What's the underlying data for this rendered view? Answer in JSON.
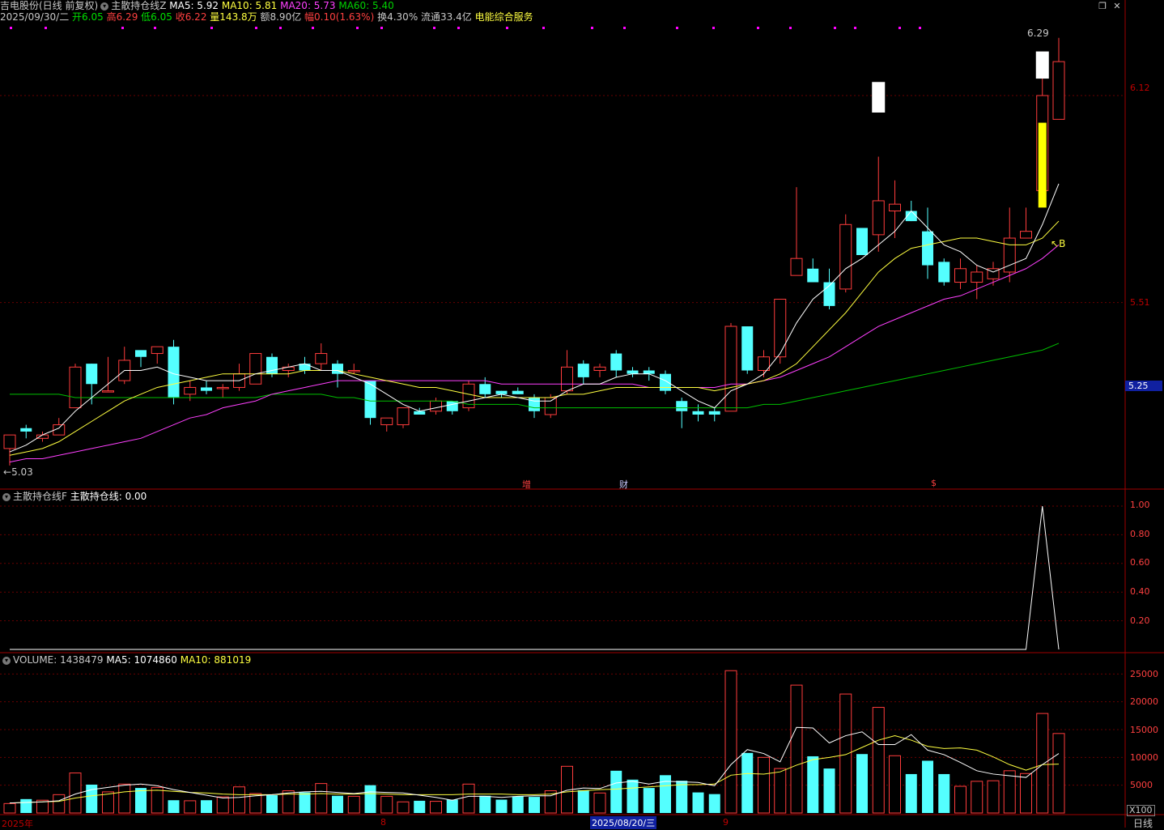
{
  "header": {
    "stock_name": "吉电股份(日线 前复权)",
    "indicator_name": "主散持仓线Z",
    "ma5": "MA5: 5.92",
    "ma10": "MA10: 5.81",
    "ma20": "MA20: 5.73",
    "ma60": "MA60: 5.40"
  },
  "quote": {
    "date": "2025/09/30/二",
    "open": "开6.05",
    "high": "高6.29",
    "low": "低6.05",
    "close": "收6.22",
    "volume": "量143.8万",
    "amount": "额8.90亿",
    "change": "幅0.10(1.63%)",
    "turnover": "换4.30%",
    "float_cap": "流通33.4亿",
    "sector": "电能综合服务"
  },
  "price_pane": {
    "high_label": "6.29",
    "low_label": "5.03",
    "signal_label": "B",
    "axis_ticks": [
      "6.12",
      "5.51",
      "5.25"
    ],
    "events": [
      "增",
      "财",
      "$"
    ]
  },
  "indicator_pane": {
    "title": "主散持仓线F",
    "value_label": "主散持仓线: 0.00",
    "axis_ticks": [
      "1.00",
      "0.80",
      "0.60",
      "0.40",
      "0.20"
    ]
  },
  "volume_pane": {
    "title": "VOLUME: 1438479",
    "ma5": "MA5: 1074860",
    "ma10": "MA10: 881019",
    "axis_ticks": [
      "25000",
      "20000",
      "15000",
      "10000",
      "5000"
    ],
    "unit": "X100"
  },
  "time_axis": {
    "labels": [
      "2025年",
      "8",
      "2025/08/20/三",
      "9"
    ],
    "period_button": "日线"
  },
  "colors": {
    "up": "#ff3c3c",
    "down": "#54ffff",
    "ma5": "#ffffff",
    "ma10": "#ffff40",
    "ma20": "#ff40ff",
    "ma60": "#00c000",
    "axis": "#a00000"
  },
  "chart_data": {
    "type": "candlestick",
    "price_unit": "CNY",
    "candles": [
      {
        "o": 5.08,
        "h": 5.12,
        "l": 5.03,
        "c": 5.12
      },
      {
        "o": 5.14,
        "h": 5.15,
        "l": 5.11,
        "c": 5.13
      },
      {
        "o": 5.11,
        "h": 5.13,
        "l": 5.1,
        "c": 5.12
      },
      {
        "o": 5.12,
        "h": 5.17,
        "l": 5.12,
        "c": 5.15
      },
      {
        "o": 5.2,
        "h": 5.33,
        "l": 5.2,
        "c": 5.32
      },
      {
        "o": 5.33,
        "h": 5.33,
        "l": 5.21,
        "c": 5.27
      },
      {
        "o": 5.25,
        "h": 5.35,
        "l": 5.25,
        "c": 5.25
      },
      {
        "o": 5.28,
        "h": 5.38,
        "l": 5.27,
        "c": 5.34
      },
      {
        "o": 5.37,
        "h": 5.36,
        "l": 5.32,
        "c": 5.35
      },
      {
        "o": 5.36,
        "h": 5.37,
        "l": 5.33,
        "c": 5.38
      },
      {
        "o": 5.38,
        "h": 5.4,
        "l": 5.21,
        "c": 5.23
      },
      {
        "o": 5.24,
        "h": 5.28,
        "l": 5.22,
        "c": 5.26
      },
      {
        "o": 5.26,
        "h": 5.28,
        "l": 5.24,
        "c": 5.25
      },
      {
        "o": 5.26,
        "h": 5.27,
        "l": 5.23,
        "c": 5.26
      },
      {
        "o": 5.26,
        "h": 5.33,
        "l": 5.25,
        "c": 5.3
      },
      {
        "o": 5.27,
        "h": 5.36,
        "l": 5.27,
        "c": 5.36
      },
      {
        "o": 5.35,
        "h": 5.36,
        "l": 5.29,
        "c": 5.3
      },
      {
        "o": 5.31,
        "h": 5.33,
        "l": 5.29,
        "c": 5.32
      },
      {
        "o": 5.33,
        "h": 5.35,
        "l": 5.3,
        "c": 5.31
      },
      {
        "o": 5.33,
        "h": 5.39,
        "l": 5.31,
        "c": 5.36
      },
      {
        "o": 5.33,
        "h": 5.34,
        "l": 5.26,
        "c": 5.3
      },
      {
        "o": 5.31,
        "h": 5.33,
        "l": 5.3,
        "c": 5.31
      },
      {
        "o": 5.28,
        "h": 5.28,
        "l": 5.15,
        "c": 5.17
      },
      {
        "o": 5.15,
        "h": 5.17,
        "l": 5.13,
        "c": 5.17
      },
      {
        "o": 5.15,
        "h": 5.2,
        "l": 5.14,
        "c": 5.2
      },
      {
        "o": 5.19,
        "h": 5.2,
        "l": 5.18,
        "c": 5.18
      },
      {
        "o": 5.19,
        "h": 5.23,
        "l": 5.18,
        "c": 5.22
      },
      {
        "o": 5.22,
        "h": 5.22,
        "l": 5.18,
        "c": 5.19
      },
      {
        "o": 5.2,
        "h": 5.28,
        "l": 5.19,
        "c": 5.27
      },
      {
        "o": 5.27,
        "h": 5.29,
        "l": 5.23,
        "c": 5.24
      },
      {
        "o": 5.25,
        "h": 5.25,
        "l": 5.23,
        "c": 5.24
      },
      {
        "o": 5.25,
        "h": 5.26,
        "l": 5.24,
        "c": 5.24
      },
      {
        "o": 5.23,
        "h": 5.24,
        "l": 5.17,
        "c": 5.19
      },
      {
        "o": 5.18,
        "h": 5.24,
        "l": 5.17,
        "c": 5.23
      },
      {
        "o": 5.25,
        "h": 5.37,
        "l": 5.24,
        "c": 5.32
      },
      {
        "o": 5.33,
        "h": 5.34,
        "l": 5.27,
        "c": 5.29
      },
      {
        "o": 5.31,
        "h": 5.33,
        "l": 5.29,
        "c": 5.32
      },
      {
        "o": 5.36,
        "h": 5.37,
        "l": 5.29,
        "c": 5.31
      },
      {
        "o": 5.31,
        "h": 5.32,
        "l": 5.29,
        "c": 5.3
      },
      {
        "o": 5.31,
        "h": 5.32,
        "l": 5.28,
        "c": 5.3
      },
      {
        "o": 5.3,
        "h": 5.31,
        "l": 5.24,
        "c": 5.25
      },
      {
        "o": 5.22,
        "h": 5.23,
        "l": 5.14,
        "c": 5.19
      },
      {
        "o": 5.19,
        "h": 5.21,
        "l": 5.16,
        "c": 5.18
      },
      {
        "o": 5.19,
        "h": 5.2,
        "l": 5.16,
        "c": 5.18
      },
      {
        "o": 5.19,
        "h": 5.45,
        "l": 5.19,
        "c": 5.44
      },
      {
        "o": 5.44,
        "h": 5.44,
        "l": 5.3,
        "c": 5.31
      },
      {
        "o": 5.31,
        "h": 5.37,
        "l": 5.29,
        "c": 5.35
      },
      {
        "o": 5.35,
        "h": 5.52,
        "l": 5.33,
        "c": 5.52
      },
      {
        "o": 5.59,
        "h": 5.85,
        "l": 5.59,
        "c": 5.64
      },
      {
        "o": 5.61,
        "h": 5.64,
        "l": 5.57,
        "c": 5.57
      },
      {
        "o": 5.57,
        "h": 5.61,
        "l": 5.49,
        "c": 5.5
      },
      {
        "o": 5.55,
        "h": 5.77,
        "l": 5.54,
        "c": 5.74
      },
      {
        "o": 5.73,
        "h": 5.73,
        "l": 5.65,
        "c": 5.65
      },
      {
        "o": 5.71,
        "h": 5.94,
        "l": 5.66,
        "c": 5.81
      },
      {
        "o": 5.78,
        "h": 5.87,
        "l": 5.7,
        "c": 5.8
      },
      {
        "o": 5.78,
        "h": 5.81,
        "l": 5.75,
        "c": 5.75
      },
      {
        "o": 5.72,
        "h": 5.79,
        "l": 5.58,
        "c": 5.62
      },
      {
        "o": 5.63,
        "h": 5.64,
        "l": 5.56,
        "c": 5.57
      },
      {
        "o": 5.57,
        "h": 5.64,
        "l": 5.55,
        "c": 5.61
      },
      {
        "o": 5.57,
        "h": 5.62,
        "l": 5.52,
        "c": 5.6
      },
      {
        "o": 5.58,
        "h": 5.63,
        "l": 5.56,
        "c": 5.61
      },
      {
        "o": 5.6,
        "h": 5.79,
        "l": 5.57,
        "c": 5.7
      },
      {
        "o": 5.7,
        "h": 5.79,
        "l": 5.7,
        "c": 5.72
      },
      {
        "o": 5.84,
        "h": 6.25,
        "l": 5.84,
        "c": 6.12
      },
      {
        "o": 6.05,
        "h": 6.29,
        "l": 6.05,
        "c": 6.22
      }
    ],
    "ma5": [
      5.07,
      5.09,
      5.12,
      5.14,
      5.19,
      5.23,
      5.27,
      5.31,
      5.31,
      5.32,
      5.3,
      5.29,
      5.28,
      5.28,
      5.28,
      5.3,
      5.31,
      5.32,
      5.33,
      5.31,
      5.31,
      5.29,
      5.27,
      5.24,
      5.21,
      5.19,
      5.2,
      5.21,
      5.22,
      5.23,
      5.24,
      5.23,
      5.22,
      5.22,
      5.25,
      5.27,
      5.27,
      5.29,
      5.3,
      5.3,
      5.28,
      5.25,
      5.22,
      5.2,
      5.25,
      5.27,
      5.3,
      5.36,
      5.45,
      5.52,
      5.56,
      5.61,
      5.64,
      5.68,
      5.72,
      5.78,
      5.73,
      5.68,
      5.66,
      5.62,
      5.6,
      5.62,
      5.64,
      5.74,
      5.86
    ],
    "ma10": [
      5.06,
      5.07,
      5.08,
      5.1,
      5.13,
      5.16,
      5.19,
      5.22,
      5.24,
      5.26,
      5.27,
      5.28,
      5.29,
      5.3,
      5.3,
      5.3,
      5.3,
      5.3,
      5.31,
      5.31,
      5.31,
      5.3,
      5.29,
      5.28,
      5.27,
      5.26,
      5.26,
      5.25,
      5.24,
      5.23,
      5.23,
      5.23,
      5.23,
      5.23,
      5.24,
      5.24,
      5.25,
      5.26,
      5.26,
      5.26,
      5.26,
      5.26,
      5.26,
      5.25,
      5.26,
      5.27,
      5.28,
      5.3,
      5.33,
      5.38,
      5.43,
      5.48,
      5.54,
      5.6,
      5.64,
      5.67,
      5.68,
      5.69,
      5.7,
      5.7,
      5.69,
      5.68,
      5.68,
      5.7,
      5.75
    ],
    "ma20": [
      5.04,
      5.05,
      5.05,
      5.06,
      5.07,
      5.08,
      5.09,
      5.1,
      5.11,
      5.13,
      5.15,
      5.17,
      5.18,
      5.2,
      5.21,
      5.22,
      5.24,
      5.25,
      5.26,
      5.27,
      5.28,
      5.28,
      5.28,
      5.28,
      5.28,
      5.28,
      5.28,
      5.28,
      5.28,
      5.28,
      5.27,
      5.27,
      5.27,
      5.27,
      5.27,
      5.27,
      5.27,
      5.27,
      5.27,
      5.26,
      5.26,
      5.26,
      5.26,
      5.26,
      5.27,
      5.27,
      5.28,
      5.29,
      5.31,
      5.33,
      5.35,
      5.38,
      5.41,
      5.44,
      5.46,
      5.48,
      5.5,
      5.52,
      5.53,
      5.55,
      5.57,
      5.59,
      5.61,
      5.64,
      5.68
    ],
    "ma60": [
      5.24,
      5.24,
      5.24,
      5.24,
      5.23,
      5.23,
      5.23,
      5.23,
      5.23,
      5.23,
      5.23,
      5.23,
      5.23,
      5.23,
      5.23,
      5.23,
      5.24,
      5.24,
      5.24,
      5.24,
      5.23,
      5.23,
      5.22,
      5.22,
      5.22,
      5.22,
      5.22,
      5.22,
      5.21,
      5.21,
      5.21,
      5.21,
      5.2,
      5.2,
      5.2,
      5.2,
      5.2,
      5.2,
      5.2,
      5.2,
      5.2,
      5.2,
      5.2,
      5.2,
      5.2,
      5.2,
      5.21,
      5.21,
      5.22,
      5.23,
      5.24,
      5.25,
      5.26,
      5.27,
      5.28,
      5.29,
      5.3,
      5.31,
      5.32,
      5.33,
      5.34,
      5.35,
      5.36,
      5.37,
      5.39
    ],
    "indicator": [
      0,
      0,
      0,
      0,
      0,
      0,
      0,
      0,
      0,
      0,
      0,
      0,
      0,
      0,
      0,
      0,
      0,
      0,
      0,
      0,
      0,
      0,
      0,
      0,
      0,
      0,
      0,
      0,
      0,
      0,
      0,
      0,
      0,
      0,
      0,
      0,
      0,
      0,
      0,
      0,
      0,
      0,
      0,
      0,
      0,
      0,
      0,
      0,
      0,
      0,
      0,
      0,
      0,
      0,
      0,
      0,
      0,
      0,
      0,
      0,
      0,
      0,
      0,
      1.0,
      0
    ],
    "volume": [
      1700,
      2500,
      2300,
      3300,
      7200,
      5100,
      3800,
      5200,
      4500,
      4600,
      2300,
      2200,
      2300,
      2900,
      4700,
      3500,
      3200,
      4000,
      3700,
      5300,
      3100,
      3000,
      5000,
      3000,
      2000,
      2200,
      2100,
      2400,
      5200,
      3100,
      2400,
      3000,
      2900,
      4000,
      8400,
      4100,
      3600,
      7600,
      6000,
      4500,
      6800,
      5800,
      3700,
      3400,
      25600,
      10800,
      10000,
      8000,
      23000,
      10200,
      8000,
      21400,
      10600,
      19000,
      10300,
      7000,
      9400,
      7000,
      4800,
      5700,
      5800,
      7600,
      7100,
      17900,
      14300
    ],
    "volume_ma5": [
      1800,
      1900,
      2000,
      2200,
      3400,
      4200,
      4600,
      5000,
      5200,
      4900,
      4200,
      3700,
      3200,
      2700,
      2800,
      3100,
      3300,
      3600,
      3800,
      3900,
      3700,
      3500,
      3800,
      3700,
      3600,
      3200,
      2800,
      2300,
      3000,
      3000,
      2800,
      3000,
      3100,
      3100,
      4100,
      4500,
      4400,
      5400,
      5700,
      5200,
      5700,
      5600,
      5500,
      4900,
      8700,
      11400,
      10700,
      9200,
      15400,
      15300,
      12600,
      13900,
      14600,
      12300,
      12300,
      14100,
      11300,
      10500,
      9100,
      7600,
      7000,
      6700,
      6400,
      8700,
      10700
    ],
    "volume_ma10": [
      1800,
      1900,
      2000,
      2100,
      2700,
      3100,
      3400,
      3800,
      4000,
      4100,
      3900,
      3700,
      3600,
      3400,
      3300,
      3300,
      3300,
      3400,
      3400,
      3500,
      3400,
      3400,
      3500,
      3400,
      3300,
      3300,
      3300,
      3300,
      3400,
      3400,
      3400,
      3300,
      3300,
      3400,
      3800,
      4000,
      4200,
      4300,
      4500,
      4700,
      4900,
      5100,
      5100,
      5200,
      6800,
      7100,
      7000,
      7400,
      8600,
      9600,
      10000,
      10500,
      11800,
      13100,
      13900,
      13100,
      12000,
      11600,
      11700,
      11300,
      10100,
      8700,
      7700,
      8700,
      8800
    ]
  }
}
